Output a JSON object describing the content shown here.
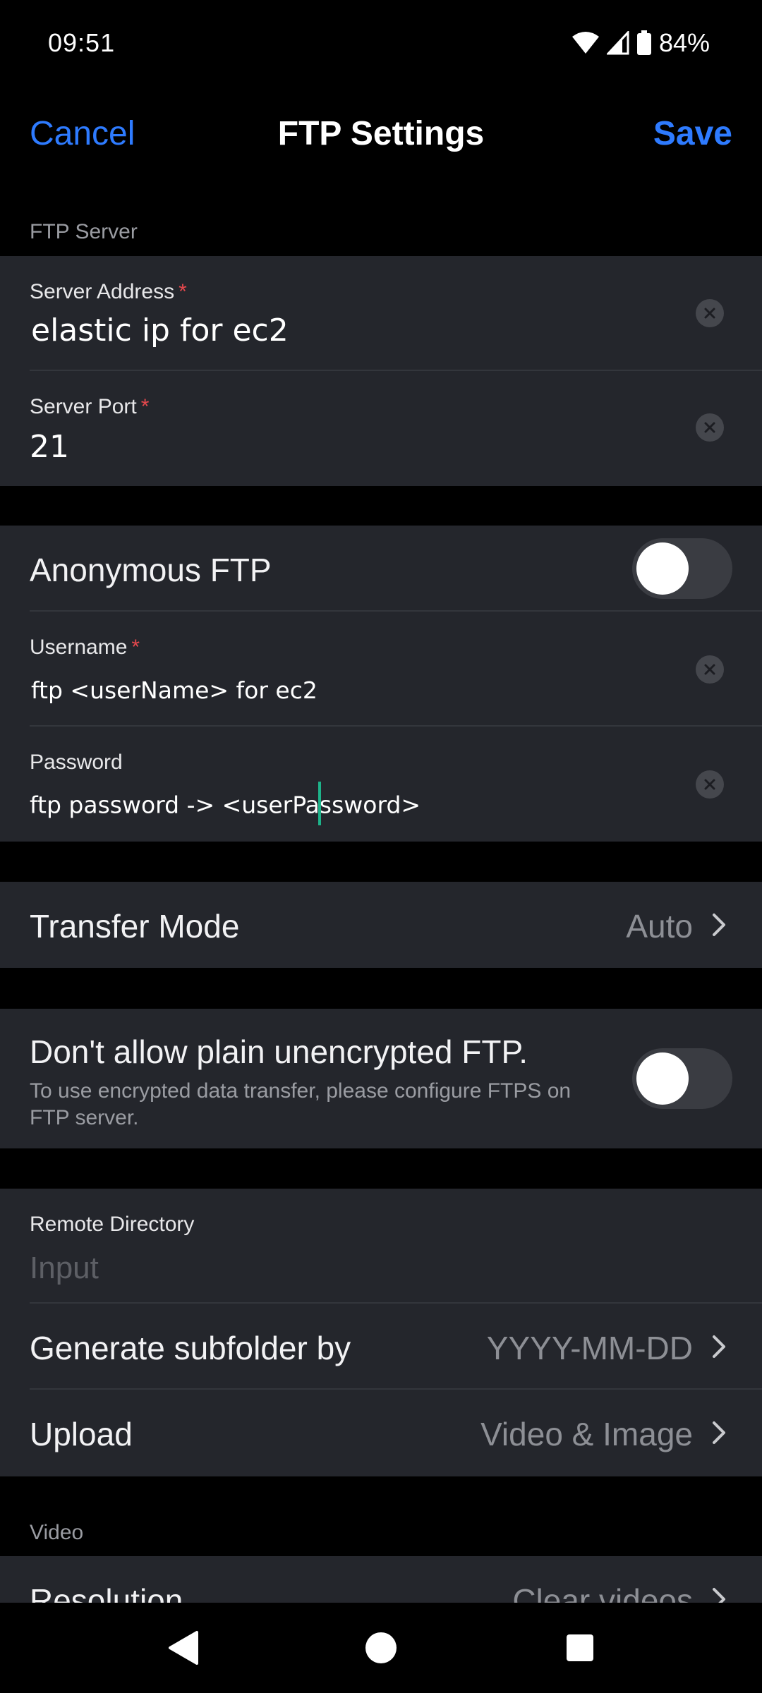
{
  "status": {
    "time": "09:51",
    "battery": "84%",
    "icons": [
      "wifi-icon",
      "signal-icon",
      "battery-icon"
    ]
  },
  "nav": {
    "cancel": "Cancel",
    "title": "FTP Settings",
    "save": "Save"
  },
  "server": {
    "section_label": "FTP Server",
    "address_label": "Server Address",
    "address_value": "elastic ip for ec2",
    "port_label": "Server Port",
    "port_value": "21",
    "required_mark": "*"
  },
  "auth": {
    "anonymous_label": "Anonymous FTP",
    "anonymous_on": false,
    "username_label": "Username",
    "username_value": "ftp <userName> for ec2",
    "password_label": "Password",
    "password_before_cursor": "ftp password -> <userPa",
    "password_after_cursor": "ssword>"
  },
  "transfer": {
    "label": "Transfer Mode",
    "value": "Auto"
  },
  "encryption": {
    "title": "Don't allow plain unencrypted FTP.",
    "description": "To use encrypted data transfer, please configure FTPS on FTP server.",
    "enabled": false
  },
  "remote": {
    "dir_label": "Remote Directory",
    "dir_placeholder": "Input",
    "subfolder_label": "Generate subfolder by",
    "subfolder_value": "YYYY-MM-DD",
    "upload_label": "Upload",
    "upload_value": "Video & Image"
  },
  "video": {
    "section_label": "Video",
    "resolution_label": "Resolution",
    "resolution_value": "Clear videos"
  },
  "colors": {
    "accent": "#2e7bff",
    "background": "#000000",
    "card": "#24262c",
    "required": "#e5484d",
    "cursor": "#1db38a"
  }
}
